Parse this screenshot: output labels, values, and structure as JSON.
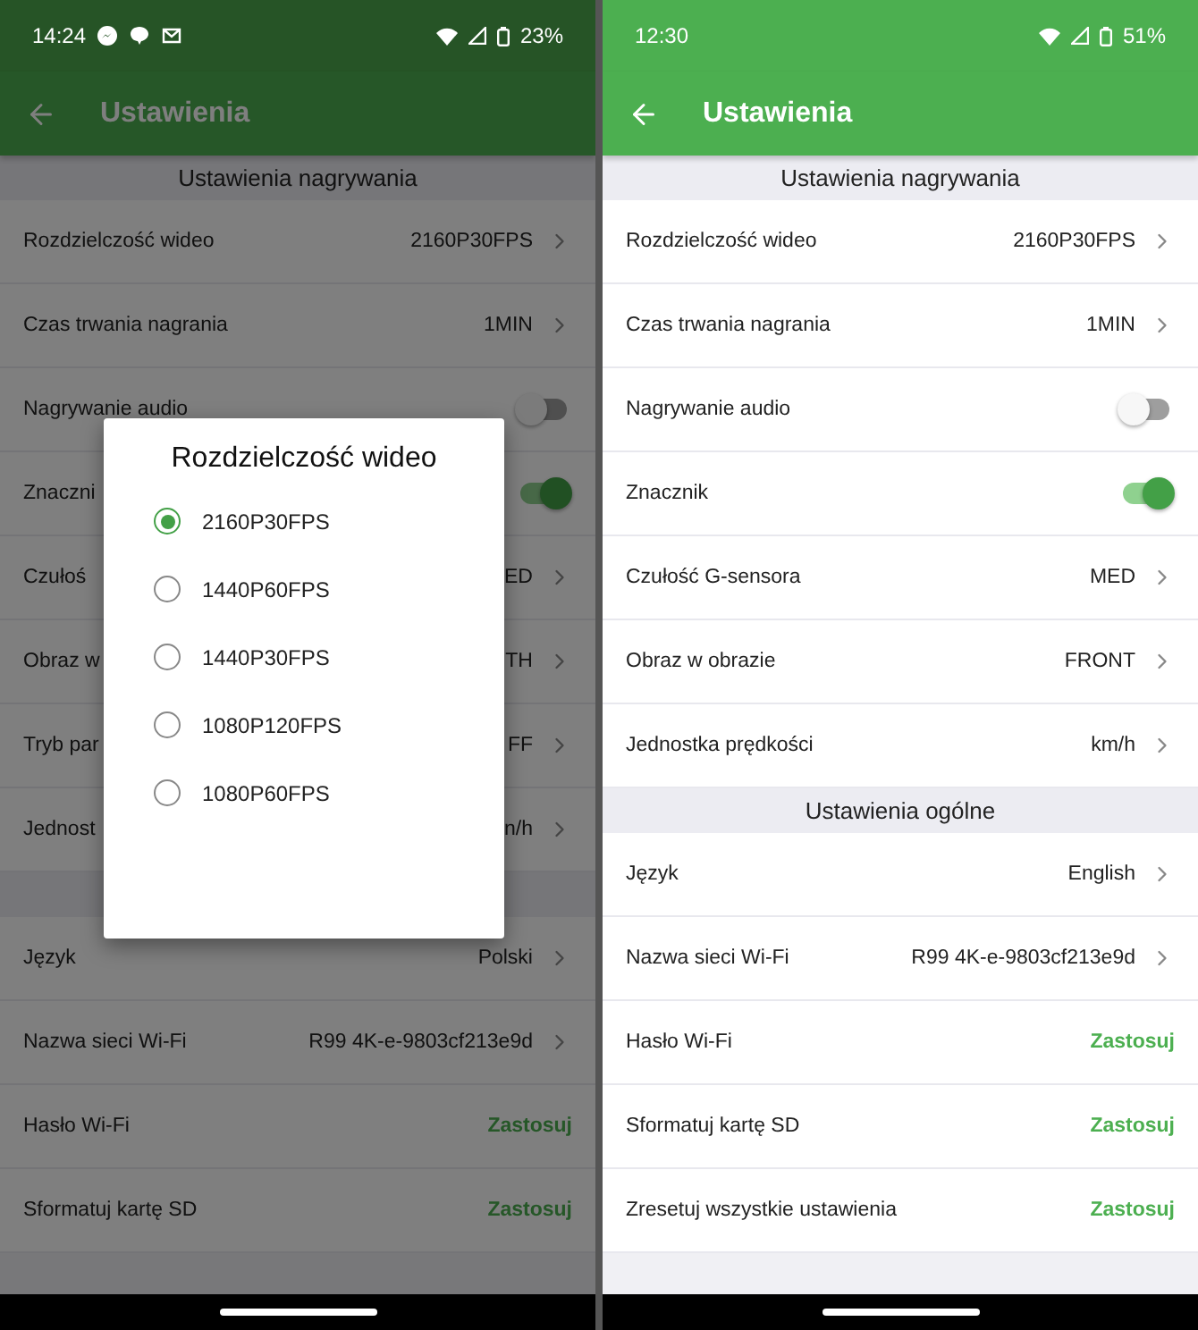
{
  "phones": [
    {
      "dimmed": true,
      "status_bar": {
        "time": "14:24",
        "notifications": [
          {
            "kind": "messenger"
          },
          {
            "kind": "chat"
          },
          {
            "kind": "mail"
          }
        ],
        "battery": "23%"
      },
      "app_bar": {
        "title": "Ustawienia"
      },
      "sections": [
        {
          "title": "Ustawienia nagrywania",
          "rows": [
            {
              "kind": "value",
              "label": "Rozdzielczość wideo",
              "value": "2160P30FPS"
            },
            {
              "kind": "value",
              "label": "Czas trwania nagrania",
              "value": "1MIN"
            },
            {
              "kind": "toggle",
              "label": "Nagrywanie audio",
              "on": false
            },
            {
              "kind": "toggle",
              "label": "Znaczni",
              "on": true
            },
            {
              "kind": "value",
              "label": "Czułoś",
              "value": "ED"
            },
            {
              "kind": "value",
              "label": "Obraz w",
              "value": "TH"
            },
            {
              "kind": "value",
              "label": "Tryb par",
              "value": "FF"
            },
            {
              "kind": "value",
              "label": "Jednost",
              "value": "n/h"
            }
          ]
        },
        {
          "rows": [
            {
              "kind": "value",
              "label": "Język",
              "value": "Polski"
            },
            {
              "kind": "value",
              "label": "Nazwa sieci Wi-Fi",
              "value": "R99 4K-e-9803cf213e9d"
            },
            {
              "kind": "action",
              "label": "Hasło Wi-Fi",
              "action": "Zastosuj"
            },
            {
              "kind": "action",
              "label": "Sformatuj kartę SD",
              "action": "Zastosuj"
            }
          ]
        }
      ],
      "dialog": {
        "title": "Rozdzielczość wideo",
        "options": [
          {
            "label": "2160P30FPS",
            "selected": true
          },
          {
            "label": "1440P60FPS",
            "selected": false
          },
          {
            "label": "1440P30FPS",
            "selected": false
          },
          {
            "label": "1080P120FPS",
            "selected": false
          },
          {
            "label": "1080P60FPS",
            "selected": false
          }
        ]
      }
    },
    {
      "dimmed": false,
      "status_bar": {
        "time": "12:30",
        "battery": "51%"
      },
      "app_bar": {
        "title": "Ustawienia"
      },
      "sections": [
        {
          "title": "Ustawienia nagrywania",
          "rows": [
            {
              "kind": "value",
              "label": "Rozdzielczość wideo",
              "value": "2160P30FPS"
            },
            {
              "kind": "value",
              "label": "Czas trwania nagrania",
              "value": "1MIN"
            },
            {
              "kind": "toggle",
              "label": "Nagrywanie audio",
              "on": false
            },
            {
              "kind": "toggle",
              "label": "Znacznik",
              "on": true
            },
            {
              "kind": "value",
              "label": "Czułość G-sensora",
              "value": "MED"
            },
            {
              "kind": "value",
              "label": "Obraz w obrazie",
              "value": "FRONT"
            },
            {
              "kind": "value",
              "label": "Jednostka prędkości",
              "value": "km/h"
            }
          ]
        },
        {
          "title": "Ustawienia ogólne",
          "rows": [
            {
              "kind": "value",
              "label": "Język",
              "value": "English"
            },
            {
              "kind": "value",
              "label": "Nazwa sieci Wi-Fi",
              "value": "R99 4K-e-9803cf213e9d"
            },
            {
              "kind": "action",
              "label": "Hasło Wi-Fi",
              "action": "Zastosuj"
            },
            {
              "kind": "action",
              "label": "Sformatuj kartę SD",
              "action": "Zastosuj"
            },
            {
              "kind": "action",
              "label": "Zresetuj wszystkie ustawienia",
              "action": "Zastosuj"
            }
          ]
        }
      ]
    }
  ]
}
